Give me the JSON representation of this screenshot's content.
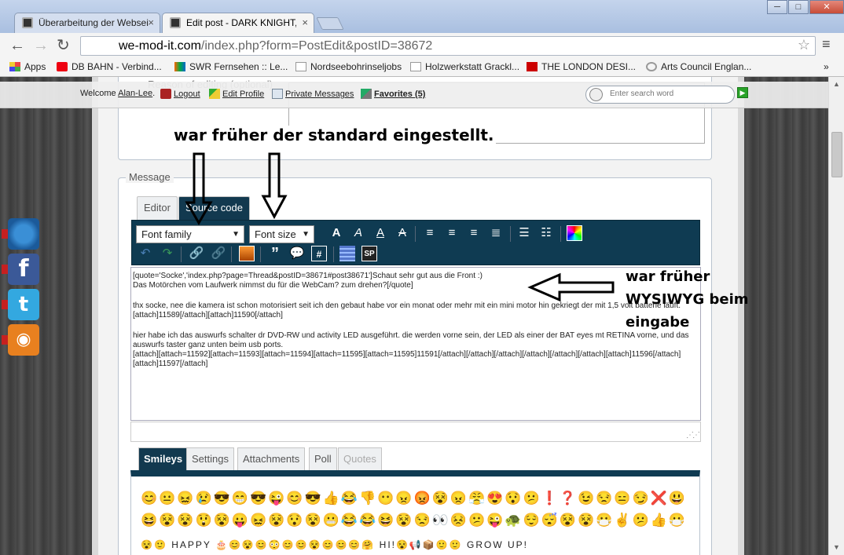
{
  "browser": {
    "tabs": [
      {
        "label": "Überarbeitung der Webseite",
        "active": false
      },
      {
        "label": "Edit post - DARK KNIGHT,",
        "active": true
      }
    ],
    "url_host": "we-mod-it.com",
    "url_path": "/index.php?form=PostEdit&postID=38672",
    "bookmarks": [
      "Apps",
      "DB BAHN - Verbind...",
      "SWR Fernsehen :: Le...",
      "Nordseebohrinseljobs",
      "Holzwerkstatt Grackl...",
      "THE LONDON DESI...",
      "Arts Council Englan..."
    ],
    "bookmarks_more": "»",
    "window_buttons": {
      "minimize": "─",
      "maximize": "□",
      "close": "✕"
    }
  },
  "userbar": {
    "welcome": "Welcome",
    "username": "Alan-Lee",
    "logout": "Logout",
    "edit_profile": "Edit Profile",
    "private_messages": "Private Messages",
    "favorites": "Favorites (5)",
    "search_placeholder": "Enter search word"
  },
  "form": {
    "reason_legend": "Reason of editing (optional)",
    "message_legend": "Message",
    "editor_tabs": [
      "Editor",
      "Source code"
    ],
    "font_family": "Font family",
    "font_size": "Font size",
    "content_lines": [
      "[quote='Socke','index.php?page=Thread&postID=38671#post38671']Schaut sehr gut aus die Front :)",
      "Das Motörchen vom Laufwerk nimmst du für die WebCam? zum drehen?[/quote]",
      "thx socke, nee die kamera ist schon motorisiert seit ich den gebaut habe vor ein monat oder mehr mit ein mini motor  hin gekriegt der mit 1,5 volt batterie läuft.[attach]11589[/attach][attach]11590[/attach]",
      "hier habe ich das auswurfs schalter dr DVD-RW und activity LED ausgeführt. die werden vorne sein, der LED als einer der BAT eyes mt RETINA vorne, und das auswurfs taster ganz unten beim usb ports.",
      "[attach][attach=11592][attach=11593][attach=11594][attach=11595][attach=11595]11591[/attach][/attach][/attach][/attach][/attach][/attach][attach]11596[/attach][attach]11597[/attach]"
    ],
    "bottom_tabs": [
      "Smileys",
      "Settings",
      "Attachments",
      "Poll",
      "Quotes"
    ],
    "smileys_row1": "😊😐😖😢😎😁😎😜😊😎👍😂👎😶😠😡😵😠😤😍😯😕❗❓😉😒😑😏❌😃",
    "smileys_row2": "😆😵😵😲😵😛😖😵😯😵😬😂😂😆😵😒👀😣😕😜🐢😌😴😵😵😷✌️😕👍😷",
    "smileys_row3": "😵🙂 HAPPY 🎂😊😵😊😳😊😊😵😊😊😊🤗 HI!😵📢📦🙂🙂 GROW UP!"
  },
  "annotations": {
    "top": "war früher der standard eingestellt.",
    "right": [
      "war früher",
      "WYSIWYG beim",
      "eingabe"
    ]
  },
  "colors": {
    "toolbar_bg": "#0f3b52",
    "accent": "#12394f"
  }
}
